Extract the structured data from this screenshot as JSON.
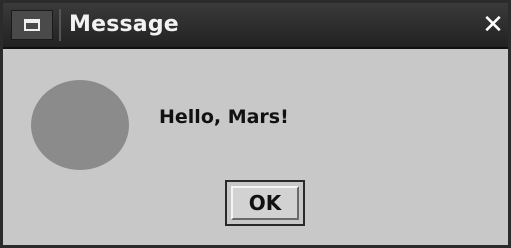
{
  "window": {
    "title": "Message",
    "close_glyph": "✕"
  },
  "icons": {
    "window_menu": "window-menu-icon",
    "message_icon": "circle-placeholder-icon",
    "close": "close-icon"
  },
  "dialog": {
    "message": "Hello, Mars!",
    "ok_label": "OK"
  },
  "colors": {
    "titlebar": "#2b2b2b",
    "dialog_background": "#c8c8c8",
    "icon_fill": "#8b8b8b"
  }
}
